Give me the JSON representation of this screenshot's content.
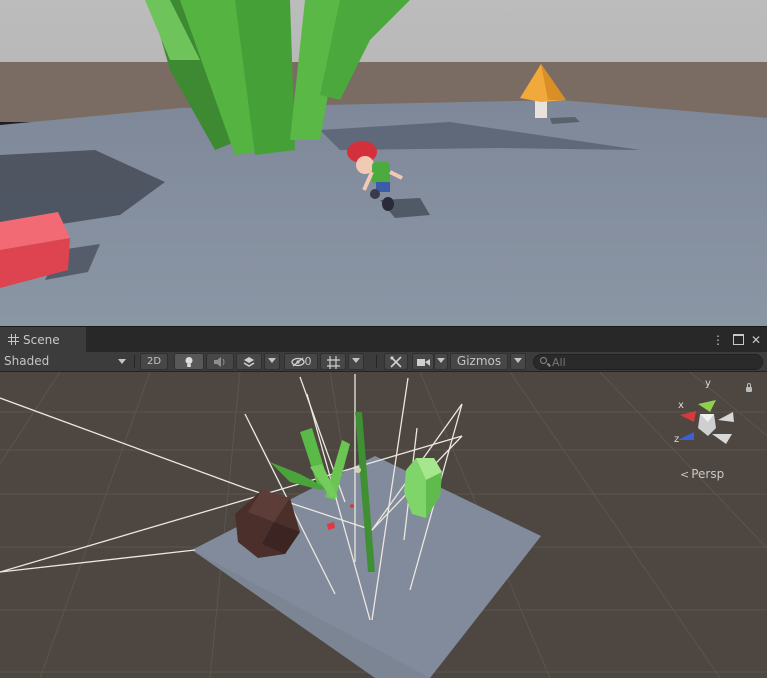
{
  "scene_tab": {
    "label": "Scene"
  },
  "toolbar": {
    "draw_mode": "Shaded",
    "mode_2d": "2D",
    "hidden_count": "0",
    "gizmos_label": "Gizmos",
    "search_placeholder": "All"
  },
  "orientation_gizmo": {
    "x_label": "x",
    "y_label": "y",
    "z_label": "z",
    "projection": "Persp"
  },
  "colors": {
    "game_sky": "#bdbdbd",
    "game_ground": "#858f9e",
    "scene_background": "#4d4641",
    "plant_green": "#4fa83b",
    "box_red": "#e04a55",
    "mushroom_cap": "#f2a93b",
    "rock_brown": "#4a2f2b"
  },
  "icons": [
    "grid-icon",
    "more-icon",
    "maximize-icon",
    "close-icon",
    "lightbulb-icon",
    "audio-icon",
    "layers-icon",
    "visibility-off-icon",
    "grid-snap-icon",
    "tools-icon",
    "camera-icon",
    "search-icon",
    "lock-icon"
  ]
}
